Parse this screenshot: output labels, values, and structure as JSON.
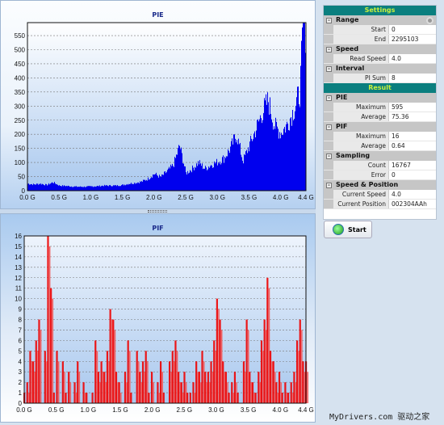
{
  "settings": {
    "header": "Settings",
    "range": {
      "label": "Range",
      "start_label": "Start",
      "start": "0",
      "end_label": "End",
      "end": "2295103"
    },
    "speed": {
      "label": "Speed",
      "read_speed_label": "Read Speed",
      "read_speed": "4.0"
    },
    "interval": {
      "label": "Interval",
      "pi_sum_label": "PI Sum",
      "pi_sum": "8"
    }
  },
  "result": {
    "header": "Result",
    "pie": {
      "label": "PIE",
      "max_label": "Maximum",
      "max": "595",
      "avg_label": "Average",
      "avg": "75.36"
    },
    "pif": {
      "label": "PIF",
      "max_label": "Maximum",
      "max": "16",
      "avg_label": "Average",
      "avg": "0.64"
    },
    "sampling": {
      "label": "Sampling",
      "count_label": "Count",
      "count": "16767",
      "error_label": "Error",
      "error": "0"
    },
    "speed_position": {
      "label": "Speed & Position",
      "cur_speed_label": "Current Speed",
      "cur_speed": "4.0",
      "cur_pos_label": "Current Position",
      "cur_pos": "002304AAh"
    }
  },
  "start_button": "Start",
  "watermark": "MyDrivers.com 驱动之家",
  "colors": {
    "pie": "#0000ee",
    "pif": "#ee0000",
    "header": "#0b7f7f"
  },
  "chart_data": [
    {
      "type": "bar",
      "title": "PIE",
      "xlim": [
        0,
        4.4
      ],
      "ylim": [
        0,
        596
      ],
      "grid": true,
      "x_ticks": [
        "0.0 G",
        "0.5 G",
        "1.0 G",
        "1.5 G",
        "2.0 G",
        "2.5 G",
        "3.0 G",
        "3.5 G",
        "4.0 G",
        "4.4 G"
      ],
      "y_ticks": [
        "0",
        "50",
        "100",
        "150",
        "200",
        "250",
        "300",
        "350",
        "400",
        "450",
        "500",
        "550"
      ],
      "x": [
        0.0,
        0.1,
        0.2,
        0.3,
        0.4,
        0.5,
        0.6,
        0.7,
        0.8,
        0.9,
        1.0,
        1.1,
        1.2,
        1.3,
        1.4,
        1.5,
        1.6,
        1.7,
        1.8,
        1.9,
        2.0,
        2.1,
        2.2,
        2.3,
        2.4,
        2.5,
        2.6,
        2.7,
        2.8,
        2.9,
        3.0,
        3.1,
        3.2,
        3.3,
        3.4,
        3.5,
        3.6,
        3.7,
        3.8,
        3.9,
        4.0,
        4.1,
        4.2,
        4.3,
        4.35,
        4.4
      ],
      "values": [
        25,
        22,
        25,
        20,
        30,
        18,
        17,
        15,
        14,
        14,
        15,
        16,
        18,
        18,
        18,
        20,
        25,
        28,
        32,
        42,
        60,
        48,
        68,
        90,
        160,
        62,
        78,
        100,
        78,
        92,
        102,
        115,
        150,
        200,
        105,
        160,
        215,
        275,
        320,
        230,
        205,
        235,
        285,
        350,
        590,
        565
      ]
    },
    {
      "type": "bar",
      "title": "PIF",
      "xlim": [
        0,
        4.4
      ],
      "ylim": [
        0,
        16
      ],
      "grid": true,
      "x_ticks": [
        "0.0 G",
        "0.5 G",
        "1.0 G",
        "1.5 G",
        "2.0 G",
        "2.5 G",
        "3.0 G",
        "3.5 G",
        "4.0 G",
        "4.4 G"
      ],
      "y_ticks": [
        "0",
        "1",
        "2",
        "3",
        "4",
        "5",
        "6",
        "7",
        "8",
        "9",
        "10",
        "11",
        "12",
        "13",
        "14",
        "15",
        "16"
      ],
      "values": [
        1,
        2,
        5,
        4,
        6,
        8,
        0,
        5,
        16,
        11,
        1,
        5,
        0,
        4,
        1,
        3,
        0,
        2,
        4,
        0,
        2,
        1,
        0,
        1,
        6,
        3,
        4,
        3,
        5,
        9,
        8,
        3,
        2,
        0,
        3,
        6,
        1,
        0,
        5,
        3,
        4,
        5,
        1,
        3,
        0,
        2,
        4,
        1,
        0,
        4,
        5,
        6,
        3,
        2,
        3,
        1,
        1,
        2,
        4,
        3,
        5,
        3,
        3,
        4,
        6,
        10,
        8,
        4,
        3,
        1,
        2,
        3,
        1,
        0,
        4,
        8,
        3,
        2,
        1,
        3,
        6,
        8,
        12,
        5,
        4,
        2,
        3,
        1,
        2,
        1,
        2,
        3,
        6,
        8,
        4,
        4
      ]
    }
  ]
}
